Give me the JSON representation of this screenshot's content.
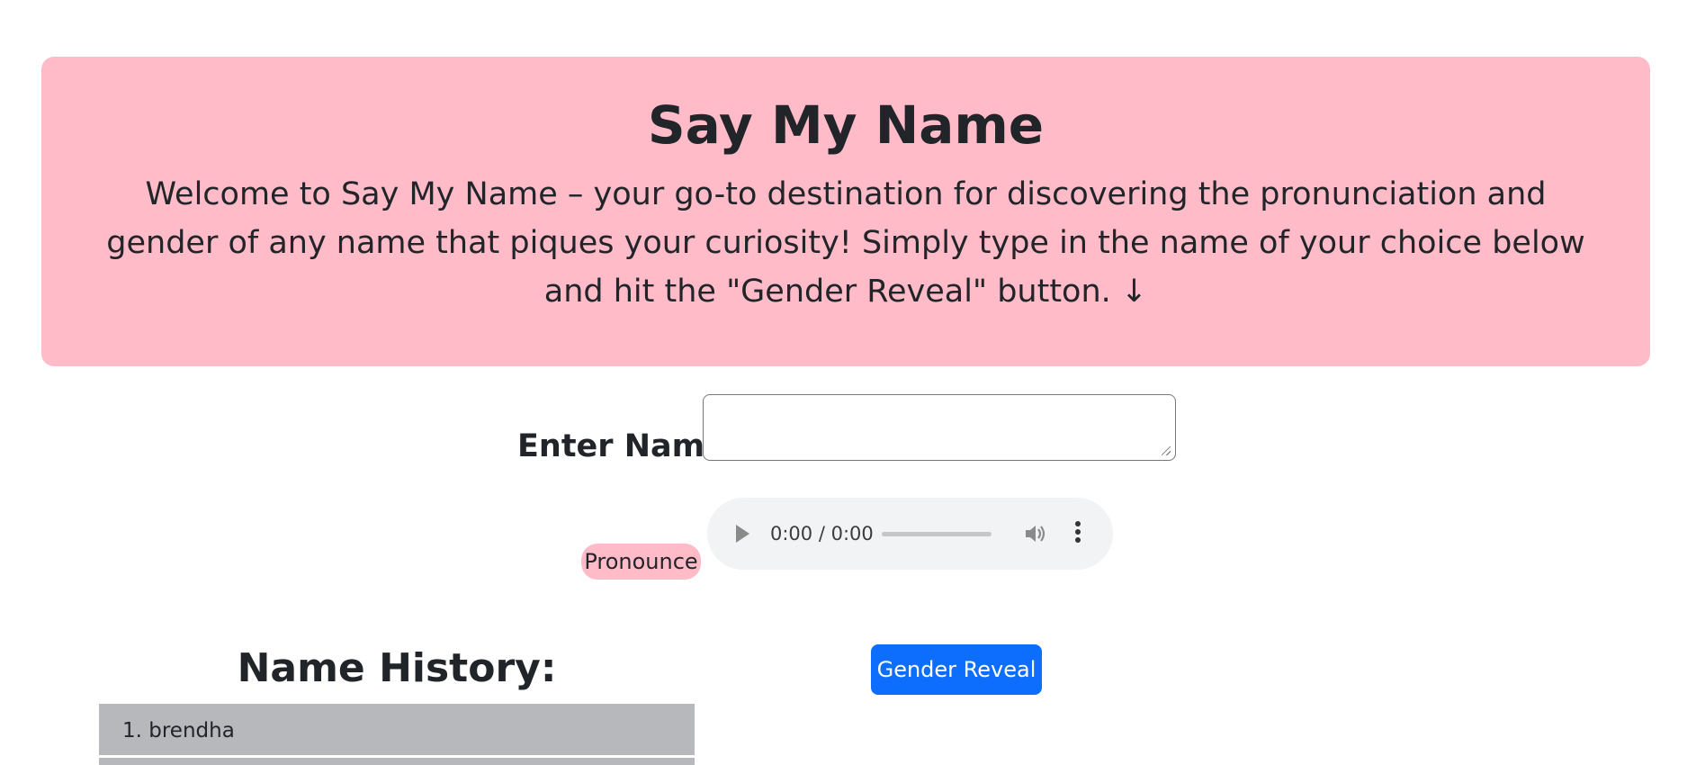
{
  "header": {
    "title": "Say My Name",
    "description": "Welcome to Say My Name – your go-to destination for discovering the pronunciation and gender of any name that piques your curiosity! Simply type in the name of your choice below and hit the \"Gender Reveal\" button. ↓"
  },
  "form": {
    "label": "Enter Name:",
    "value": ""
  },
  "pronounce": {
    "label": "Pronounce"
  },
  "audio": {
    "time": "0:00 / 0:00",
    "progress": 0
  },
  "reveal": {
    "label": "Gender Reveal"
  },
  "history": {
    "title": "Name History:",
    "items": [
      "1. brendha"
    ]
  },
  "colors": {
    "hero_bg": "#ffbbc7",
    "pronounce_bg": "#ffbbc7",
    "primary": "#0d6efd",
    "history_item_bg": "#b7b8bc"
  }
}
